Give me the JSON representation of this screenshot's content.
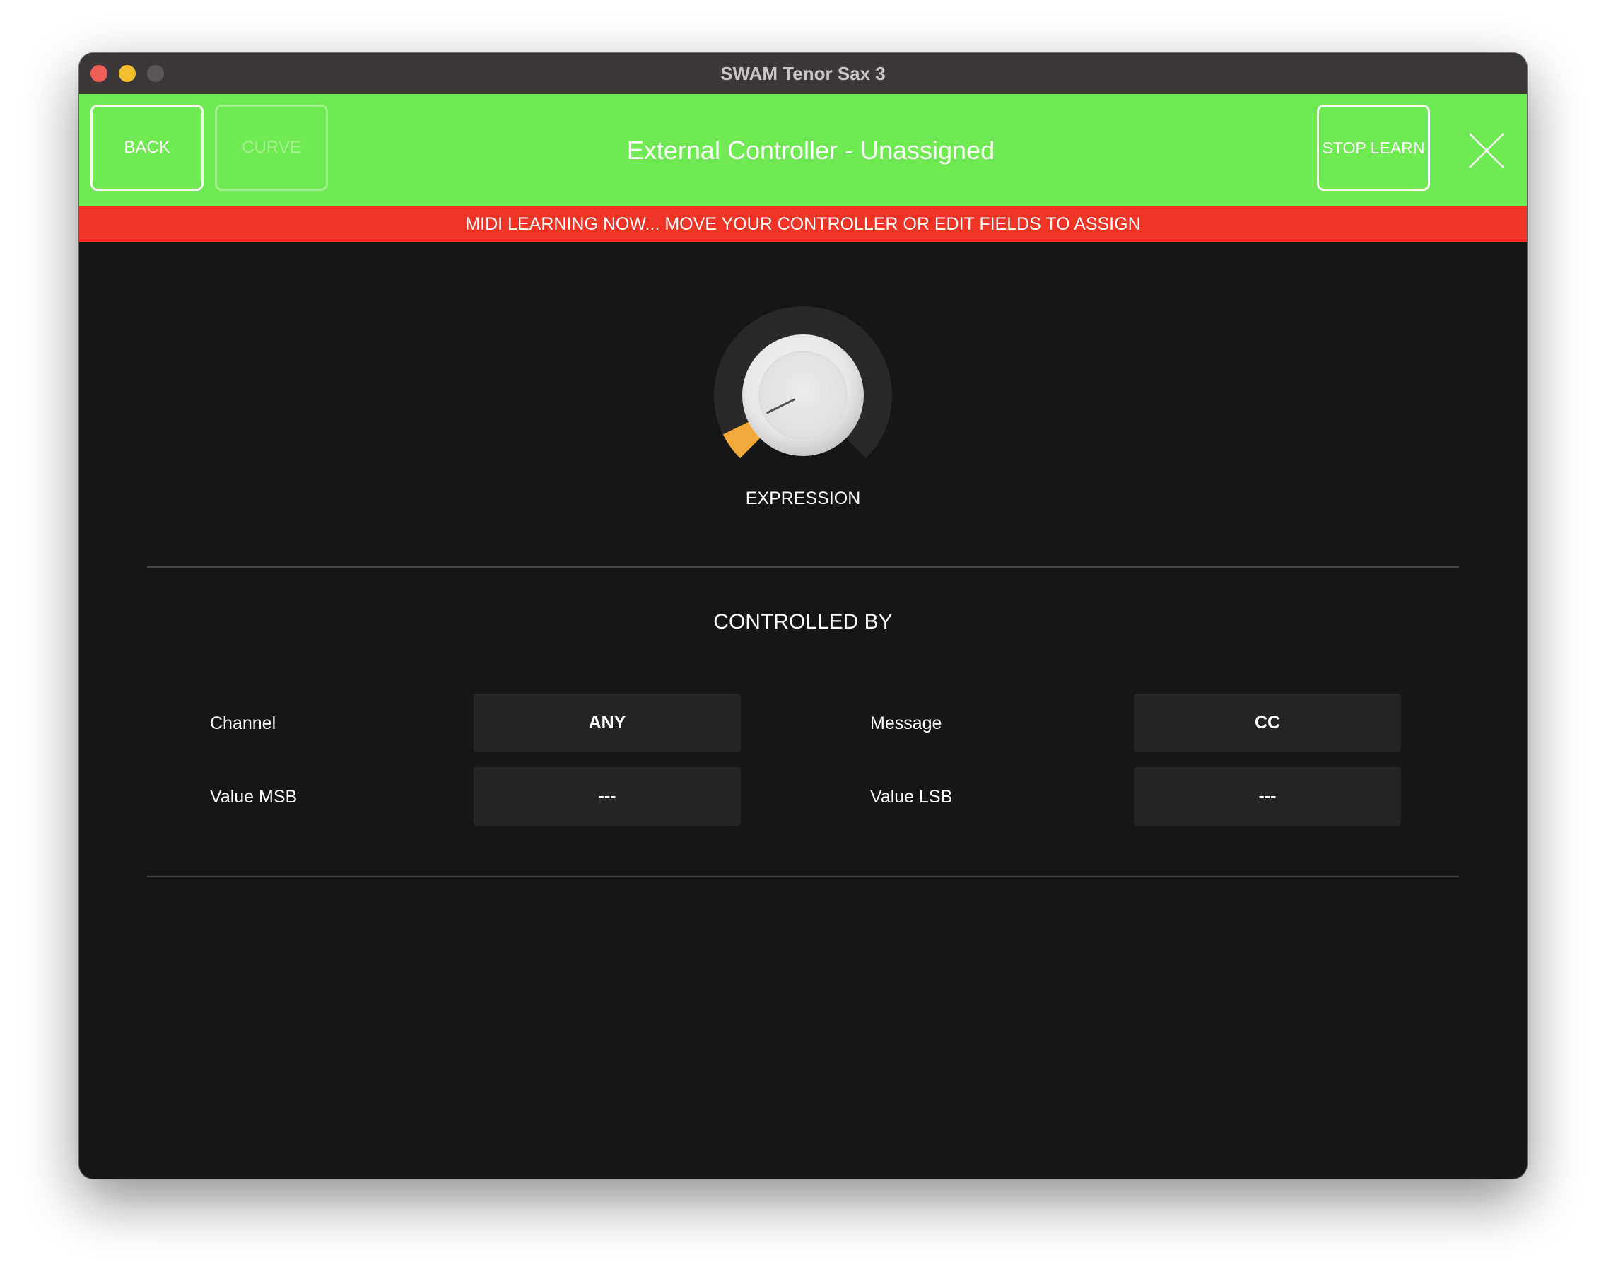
{
  "window": {
    "title": "SWAM Tenor Sax 3"
  },
  "colors": {
    "header_bg": "#70ea52",
    "banner_bg": "#ef3325",
    "body_bg": "#161616",
    "field_bg": "#272424",
    "knob_accent": "#f2a93a",
    "traffic_close": "#ee5f57",
    "traffic_min": "#f4bc2f",
    "traffic_max": "#5b5759"
  },
  "header": {
    "back_label": "BACK",
    "curve_label": "CURVE",
    "title": "External Controller - Unassigned",
    "stop_learn_label": "STOP LEARN"
  },
  "banner": {
    "text": "MIDI LEARNING NOW... MOVE YOUR CONTROLLER OR EDIT FIELDS TO ASSIGN"
  },
  "knob": {
    "label": "EXPRESSION",
    "value_fraction": 0.07
  },
  "controlled_by": {
    "title": "CONTROLLED BY",
    "channel_label": "Channel",
    "channel_value": "ANY",
    "message_label": "Message",
    "message_value": "CC",
    "value_msb_label": "Value MSB",
    "value_msb_value": "---",
    "value_lsb_label": "Value LSB",
    "value_lsb_value": "---"
  }
}
